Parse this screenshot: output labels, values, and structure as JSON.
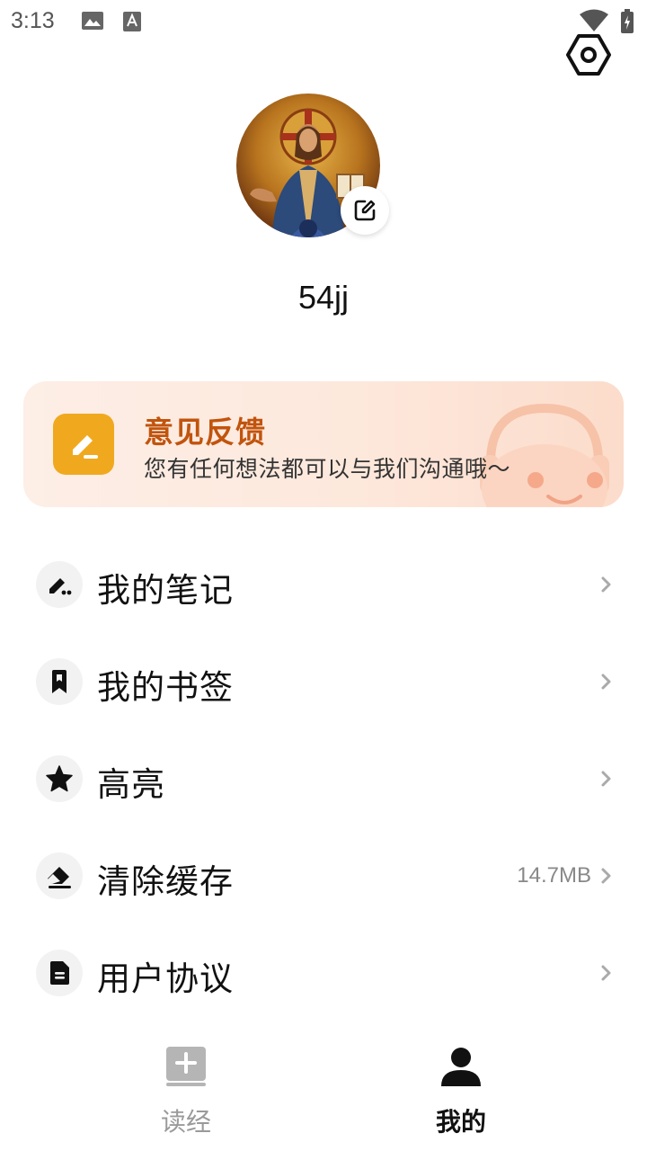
{
  "status_bar": {
    "time": "3:13",
    "icons": [
      "image-icon",
      "text-a-icon",
      "wifi-icon",
      "battery-charging-icon"
    ]
  },
  "header": {
    "settings_icon": "hex-settings-icon"
  },
  "profile": {
    "username": "54jj",
    "avatar": "avatar-image",
    "edit_icon": "edit-icon"
  },
  "feedback": {
    "title": "意见反馈",
    "subtitle": "您有任何想法都可以与我们沟通哦～",
    "icon": "pen-icon",
    "accent_color": "#f0a91f",
    "title_color": "#c1540d"
  },
  "menu": {
    "items": [
      {
        "label": "我的笔记",
        "icon": "note-pen-icon"
      },
      {
        "label": "我的书签",
        "icon": "bookmark-icon"
      },
      {
        "label": "高亮",
        "icon": "star-icon"
      },
      {
        "label": "清除缓存",
        "icon": "eraser-icon",
        "value": "14.7MB"
      },
      {
        "label": "用户协议",
        "icon": "document-icon"
      }
    ]
  },
  "bottom_nav": {
    "tabs": [
      {
        "label": "读经",
        "icon": "book-plus-icon",
        "active": false
      },
      {
        "label": "我的",
        "icon": "person-icon",
        "active": true
      }
    ]
  }
}
